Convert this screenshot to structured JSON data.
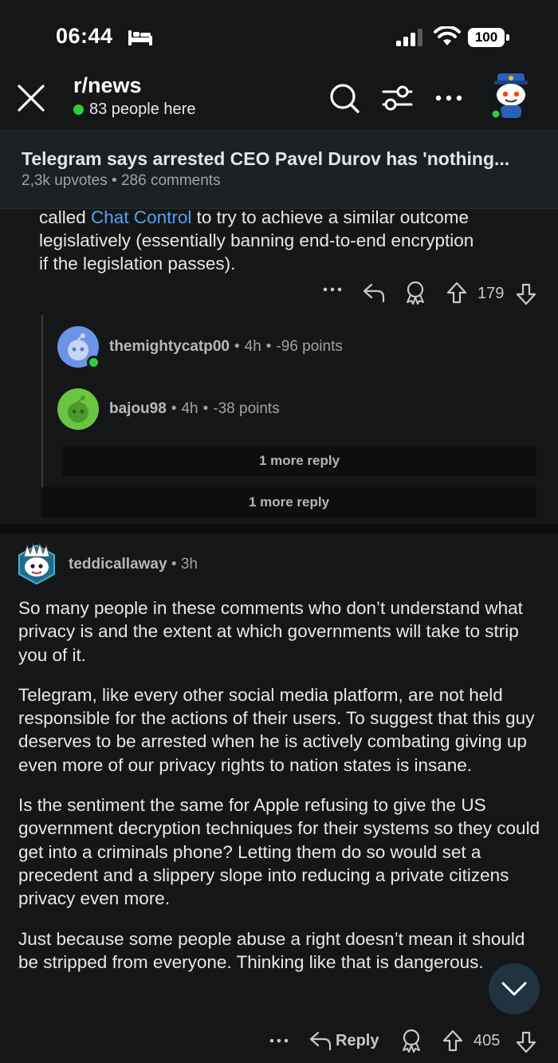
{
  "status_bar": {
    "time": "06:44",
    "battery": "100",
    "icons": [
      "bed-icon",
      "cellular-signal-icon",
      "wifi-icon",
      "battery-icon"
    ]
  },
  "top_bar": {
    "subreddit": "r/news",
    "online_text": "83 people here",
    "icons": [
      "close-icon",
      "search-icon",
      "filter-icon",
      "more-icon",
      "user-avatar"
    ]
  },
  "post": {
    "title": "Telegram says arrested CEO Pavel Durov has 'nothing...",
    "upvotes": "2,3k upvotes",
    "separator": "•",
    "comments": "286 comments"
  },
  "comment1": {
    "line1_before": "called ",
    "link": "Chat Control",
    "line1_after": " to try to achieve a similar outcome",
    "line2": "legislatively (essentially banning end-to-end encryption",
    "line3": "if the legislation passes).",
    "score": "179"
  },
  "replies": [
    {
      "username": "themightycatp00",
      "sep1": "•",
      "time": "4h",
      "sep2": "•",
      "points": "-96 points",
      "avatar_color": "#6c93e6"
    },
    {
      "username": "bajou98",
      "sep1": "•",
      "time": "4h",
      "sep2": "•",
      "points": "-38 points",
      "avatar_color": "#6ac640"
    }
  ],
  "more_reply_inner": "1 more reply",
  "more_reply_outer": "1 more reply",
  "comment2": {
    "username": "teddicallaway",
    "sep": "•",
    "time": "3h",
    "paragraphs": [
      "So many people in these comments who don’t understand what privacy is and the extent at which governments will take to strip you of it.",
      "Telegram, like every other social media platform, are not held responsible for the actions of their users. To suggest that this guy deserves to be arrested when he is actively combating giving up even more of our privacy rights to nation states is insane.",
      "Is the sentiment the same for Apple refusing to give the US government decryption techniques for their systems so they could get into a criminals phone? Letting them do so would set a precedent and a slippery slope into reducing a private citizens privacy even more.",
      "Just because some people abuse a right doesn’t mean it should be stripped from everyone. Thinking like that is dangerous."
    ],
    "reply_label": "Reply",
    "score": "405"
  }
}
